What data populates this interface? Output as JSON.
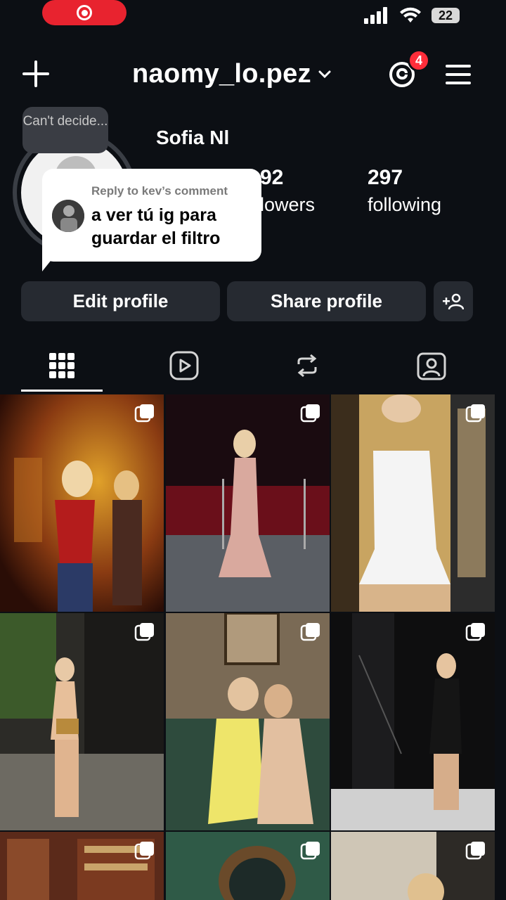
{
  "status_bar": {
    "battery": "22"
  },
  "header": {
    "username": "naomy_lo.pez",
    "notification_count": "4"
  },
  "profile": {
    "note": "Can't decide...",
    "display_name": "Sofia Nl",
    "stats": {
      "followers_count_visible": "92",
      "followers_label_visible": "llowers",
      "following_count": "297",
      "following_label": "following"
    }
  },
  "comment_reply": {
    "caption": "Reply to kev’s comment",
    "text": "a ver tú ig para guardar el filtro"
  },
  "buttons": {
    "edit_profile": "Edit profile",
    "share_profile": "Share profile"
  },
  "tabs": [
    "grid-icon",
    "reels-icon",
    "reposts-icon",
    "tagged-icon"
  ],
  "colors": {
    "background": "#0c0f14",
    "button": "#262a31",
    "badge": "#ff2d3a",
    "record": "#e8232f"
  }
}
